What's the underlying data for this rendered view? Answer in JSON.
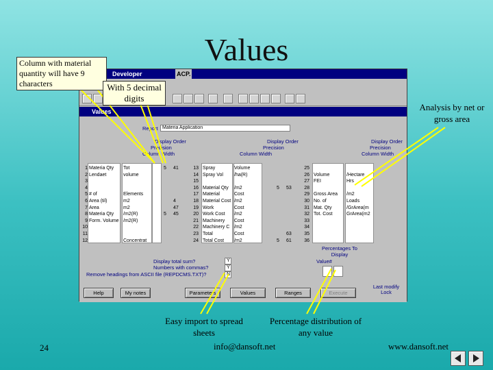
{
  "slide": {
    "title": "Values",
    "page_number": "24",
    "email": "info@dansoft.net",
    "website": "www.dansoft.net"
  },
  "callouts": {
    "material_quantity": "Column with material quantity will have 9 characters",
    "decimal_digits": "With 5 decimal digits",
    "net_gross": "Analysis by net or gross area",
    "easy_import": "Easy import to spread sheets",
    "percentage": "Percentage distribution of any value"
  },
  "app": {
    "window_title": "Developer",
    "window_title_fragment": "ACP.",
    "child_title": "Values",
    "report_label": "Report",
    "report_value": "Materia Application",
    "headers": {
      "display_order": "Display Order",
      "precision": "Precision",
      "column_width": "Column Width"
    },
    "columns": [
      {
        "rows": [
          {
            "n": "1",
            "name": "Materia Qty",
            "unit": "Tot",
            "prec": "",
            "width": "5",
            "order": "41"
          },
          {
            "n": "2",
            "name": "Lendaet",
            "unit": "volume",
            "prec": "",
            "width": "",
            "order": ""
          },
          {
            "n": "3",
            "name": "",
            "unit": "",
            "prec": "",
            "width": "",
            "order": ""
          },
          {
            "n": "4",
            "name": "",
            "unit": "",
            "prec": "",
            "width": "",
            "order": ""
          },
          {
            "n": "5",
            "name": "# of",
            "unit": "Elements",
            "prec": "",
            "width": "",
            "order": ""
          },
          {
            "n": "6",
            "name": "Area (til)",
            "unit": "m2",
            "prec": "",
            "width": "",
            "order": "4"
          },
          {
            "n": "7",
            "name": "Area",
            "unit": "m2",
            "prec": "",
            "width": "",
            "order": "47"
          },
          {
            "n": "8",
            "name": "Materia Qty",
            "unit": "/m2(R)",
            "prec": "",
            "width": "5",
            "order": "45"
          },
          {
            "n": "9",
            "name": "Form. Volume",
            "unit": "/m2(R)",
            "prec": "",
            "width": "",
            "order": ""
          },
          {
            "n": "10",
            "name": "",
            "unit": "",
            "prec": "",
            "width": "",
            "order": ""
          },
          {
            "n": "11",
            "name": "",
            "unit": "",
            "prec": "",
            "width": "",
            "order": ""
          },
          {
            "n": "12",
            "name": "",
            "unit": "Concentrat",
            "prec": "",
            "width": "",
            "order": ""
          }
        ]
      },
      {
        "rows": [
          {
            "n": "13",
            "name": "Spray",
            "unit": "Volume",
            "prec": "",
            "width": "",
            "order": ""
          },
          {
            "n": "14",
            "name": "Spray Vol",
            "unit": "/ha(R)",
            "prec": "",
            "width": "",
            "order": ""
          },
          {
            "n": "15",
            "name": "",
            "unit": "",
            "prec": "",
            "width": "",
            "order": ""
          },
          {
            "n": "16",
            "name": "Material Qty",
            "unit": "/m2",
            "prec": "",
            "width": "5",
            "order": "53"
          },
          {
            "n": "17",
            "name": "Material",
            "unit": "Cost",
            "prec": "",
            "width": "",
            "order": ""
          },
          {
            "n": "18",
            "name": "Material Cost",
            "unit": "/m2",
            "prec": "",
            "width": "",
            "order": ""
          },
          {
            "n": "19",
            "name": "Work",
            "unit": "Cost",
            "prec": "",
            "width": "",
            "order": ""
          },
          {
            "n": "20",
            "name": "Work Cost",
            "unit": "/m2",
            "prec": "",
            "width": "",
            "order": ""
          },
          {
            "n": "21",
            "name": "Machinery",
            "unit": "Cost",
            "prec": "",
            "width": "",
            "order": ""
          },
          {
            "n": "22",
            "name": "Machinery C",
            "unit": "/m2",
            "prec": "",
            "width": "",
            "order": ""
          },
          {
            "n": "23",
            "name": "Total",
            "unit": "Cost",
            "prec": "",
            "width": "",
            "order": "63"
          },
          {
            "n": "24",
            "name": "Total Cost",
            "unit": "/m2",
            "prec": "",
            "width": "5",
            "order": "61"
          }
        ]
      },
      {
        "rows": [
          {
            "n": "25",
            "name": "",
            "unit": "",
            "prec": "",
            "width": "",
            "order": ""
          },
          {
            "n": "26",
            "name": "Volume",
            "unit": "/Hectare",
            "prec": "",
            "width": "",
            "order": ""
          },
          {
            "n": "27",
            "name": "FEI",
            "unit": "Hrs",
            "prec": "",
            "width": "",
            "order": ""
          },
          {
            "n": "28",
            "name": "",
            "unit": "",
            "prec": "",
            "width": "",
            "order": ""
          },
          {
            "n": "29",
            "name": "Gross Area",
            "unit": "/m2",
            "prec": "",
            "width": "",
            "order": ""
          },
          {
            "n": "30",
            "name": "No. of",
            "unit": "Loads",
            "prec": "",
            "width": "",
            "order": ""
          },
          {
            "n": "31",
            "name": "Mat. Qty",
            "unit": "/GrArea(m",
            "prec": "",
            "width": "",
            "order": ""
          },
          {
            "n": "32",
            "name": "Tot. Cost",
            "unit": "GrArea(m2",
            "prec": "",
            "width": "",
            "order": ""
          },
          {
            "n": "33",
            "name": "",
            "unit": "",
            "prec": "",
            "width": "",
            "order": ""
          },
          {
            "n": "34",
            "name": "",
            "unit": "",
            "prec": "",
            "width": "",
            "order": ""
          },
          {
            "n": "35",
            "name": "",
            "unit": "",
            "prec": "",
            "width": "",
            "order": ""
          },
          {
            "n": "36",
            "name": "",
            "unit": "",
            "prec": "",
            "width": "",
            "order": ""
          }
        ]
      }
    ],
    "options": {
      "display_total_sum": "Display total sum?",
      "numbers_with_commas": "Numbers with commas?",
      "remove_headings": "Remove headings from ASCII file (REPDCMS.TXT)?",
      "display_total_sum_value": "Y",
      "numbers_with_commas_value": "Y",
      "remove_headings_value": "N"
    },
    "percentages": {
      "label": "Percentages To Display",
      "value_label": "Value#"
    },
    "buttons": {
      "help": "Help",
      "my_notes": "My notes",
      "parameters": "Parameters",
      "values": "Values",
      "ranges": "Ranges",
      "execute": "Execute",
      "lock": "Last modify Lock"
    }
  },
  "colors": {
    "background_top": "#8fe3e3",
    "background_bottom": "#1aa9ab",
    "arrow": "#ffff00",
    "window_title": "#000080"
  }
}
